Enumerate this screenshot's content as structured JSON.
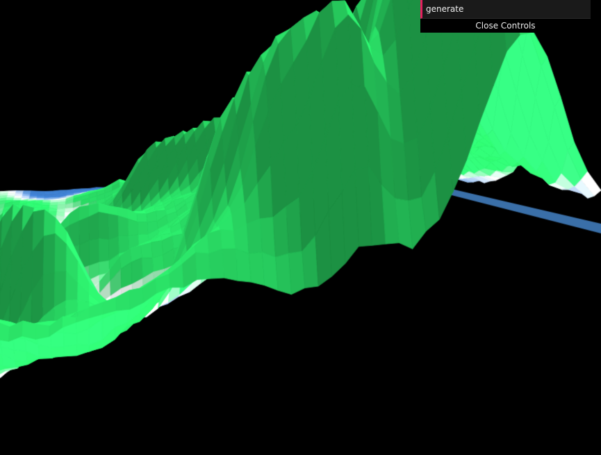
{
  "gui": {
    "buttons": [
      {
        "label": "generate"
      }
    ],
    "close_label": "Close Controls"
  },
  "scene": {
    "background": "#000000",
    "palette": {
      "low": "#3f7fcf",
      "mid": "#ffffff",
      "high": "#2ef26f",
      "side": "#3a6fa8"
    }
  }
}
